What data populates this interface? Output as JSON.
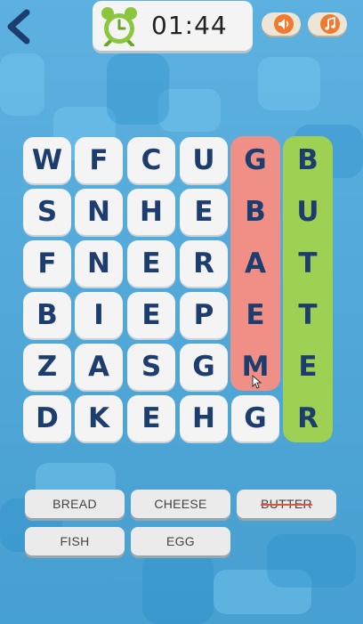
{
  "header": {
    "timer": "01:44",
    "clock_icon": "alarm-clock-icon",
    "sound_icon": "speaker-icon",
    "music_icon": "music-note-icon",
    "back_icon": "chevron-left-icon"
  },
  "grid": {
    "rows": [
      [
        "W",
        "F",
        "C",
        "U",
        "G",
        "B"
      ],
      [
        "S",
        "N",
        "H",
        "E",
        "B",
        "U"
      ],
      [
        "F",
        "N",
        "E",
        "R",
        "A",
        "T"
      ],
      [
        "B",
        "I",
        "E",
        "P",
        "E",
        "T"
      ],
      [
        "Z",
        "A",
        "S",
        "G",
        "M",
        "E"
      ],
      [
        "D",
        "K",
        "E",
        "H",
        "G",
        "R"
      ]
    ],
    "highlights": [
      {
        "color": "red",
        "col": 4,
        "from_row": 0,
        "to_row": 4
      },
      {
        "color": "green",
        "col": 5,
        "from_row": 0,
        "to_row": 5
      }
    ]
  },
  "words": [
    {
      "label": "BREAD",
      "found": false
    },
    {
      "label": "CHEESE",
      "found": false
    },
    {
      "label": "BUTTER",
      "found": true
    },
    {
      "label": "FISH",
      "found": false
    },
    {
      "label": "EGG",
      "found": false
    }
  ],
  "colors": {
    "background": "#4aa8dc",
    "tile": "#f4f4f4",
    "letter": "#1c3d6e",
    "highlight_red": "#ef8f86",
    "highlight_green": "#9ed054",
    "accent": "#f07a2e"
  }
}
